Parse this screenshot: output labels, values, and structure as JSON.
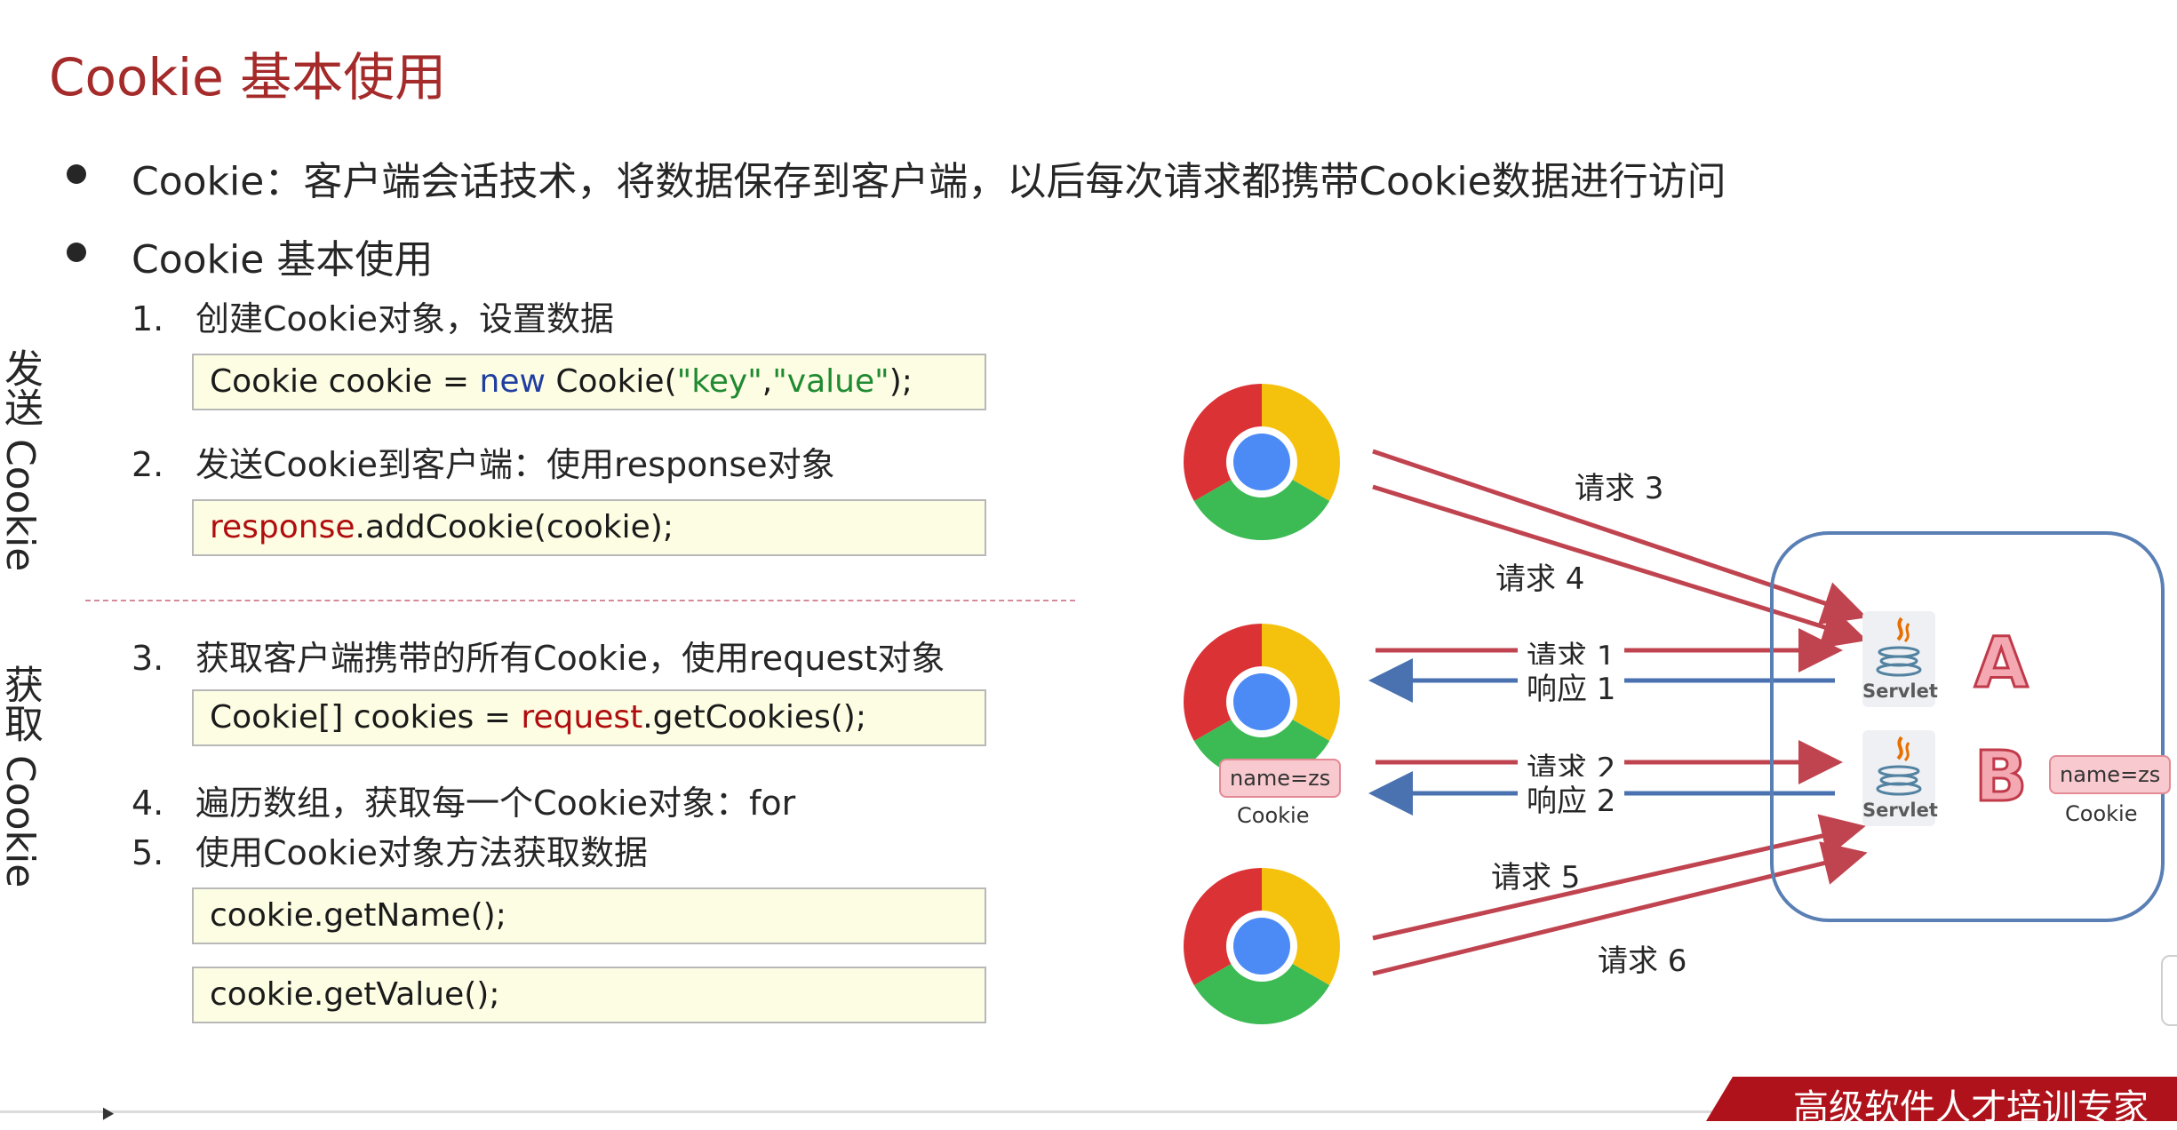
{
  "title": "Cookie 基本使用",
  "bullets": [
    "Cookie：客户端会话技术，将数据保存到客户端，以后每次请求都携带Cookie数据进行访问",
    "Cookie 基本使用"
  ],
  "side_labels": {
    "send": "发送 Cookie",
    "get": "获取 Cookie"
  },
  "steps": [
    {
      "num": "1.",
      "text": "创建Cookie对象，设置数据"
    },
    {
      "num": "2.",
      "text": "发送Cookie到客户端：使用response对象"
    },
    {
      "num": "3.",
      "text": "获取客户端携带的所有Cookie，使用request对象"
    },
    {
      "num": "4.",
      "text": "遍历数组，获取每一个Cookie对象：for"
    },
    {
      "num": "5.",
      "text": "使用Cookie对象方法获取数据"
    }
  ],
  "code": {
    "c1": {
      "a": "Cookie cookie = ",
      "kw": "new",
      "b": " Cookie(",
      "s1": "\"key\"",
      "comma": ",",
      "s2": "\"value\"",
      "end": ");"
    },
    "c2": {
      "obj": "response",
      "rest": ".addCookie(cookie);"
    },
    "c3": {
      "a": "Cookie[] cookies = ",
      "obj": "request",
      "rest": ".getCookies();"
    },
    "c4": "cookie.getName();",
    "c5": "cookie.getValue();"
  },
  "diagram": {
    "requests": [
      "请求 3",
      "请求 4",
      "请求 1",
      "响应 1",
      "请求 2",
      "响应 2",
      "请求 5",
      "请求 6"
    ],
    "cookie_badge": "name=zs",
    "cookie_caption": "Cookie",
    "servlet_label": "Servlet",
    "server_letters": [
      "A",
      "B"
    ],
    "colors": {
      "request": "#c0444f",
      "response": "#4a72b0",
      "server_border": "#5a7fb5"
    }
  },
  "footer": "高级软件人才培训专家"
}
